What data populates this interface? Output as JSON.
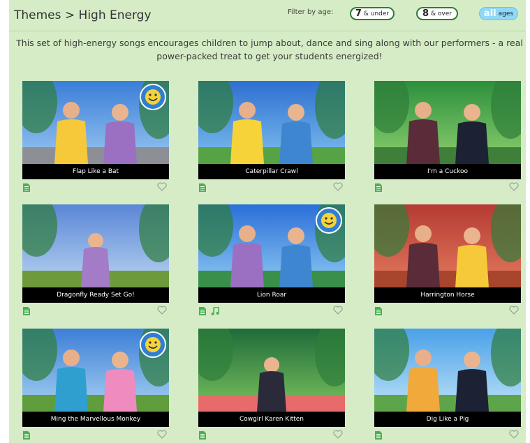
{
  "header": {
    "breadcrumb": "Themes > High Energy",
    "filter_label": "Filter by age:",
    "filters": [
      {
        "big": "7",
        "small": "& under"
      },
      {
        "big": "8",
        "small": "& over"
      },
      {
        "big": "all",
        "small": "ages"
      }
    ]
  },
  "description": "This set of high-energy songs encourages children to jump about, dance and sing along with our performers - a real power-packed treat to get your students energized!",
  "colors": {
    "page_bg": "#d5ecc6",
    "filter_border": "#2e7d32",
    "all_ages_bg": "#8fd8f7",
    "icon_green": "#4caf50"
  },
  "cards": [
    {
      "title": "Flap Like a Bat",
      "badge": true,
      "music": false
    },
    {
      "title": "Caterpillar Crawl",
      "badge": false,
      "music": false
    },
    {
      "title": "I'm a Cuckoo",
      "badge": false,
      "music": false
    },
    {
      "title": "Dragonfly Ready Set Go!",
      "badge": false,
      "music": false
    },
    {
      "title": "Lion Roar",
      "badge": true,
      "music": true
    },
    {
      "title": "Harrington Horse",
      "badge": false,
      "music": false
    },
    {
      "title": "Ming the Marvellous Monkey",
      "badge": true,
      "music": false
    },
    {
      "title": "Cowgirl Karen Kitten",
      "badge": false,
      "music": false
    },
    {
      "title": "Dig Like a Pig",
      "badge": false,
      "music": false
    }
  ],
  "icons": {
    "document": "document-icon",
    "music": "music-note-icon",
    "favorite": "heart-icon",
    "age_badge": "smiley-badge-icon"
  }
}
